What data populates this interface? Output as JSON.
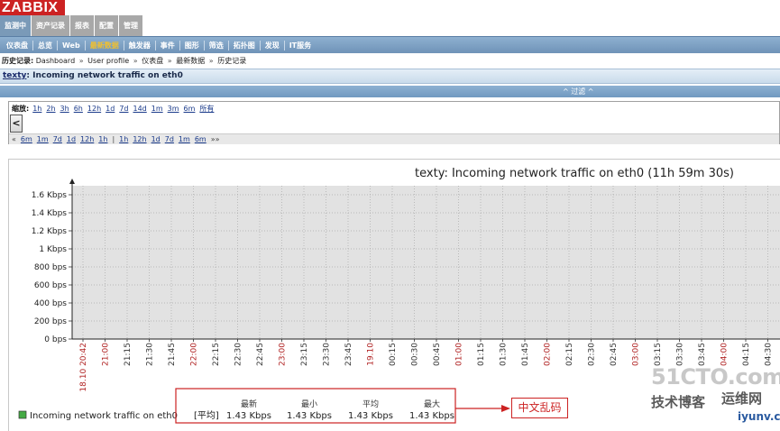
{
  "app": {
    "logo": "ZABBIX",
    "main_tabs": [
      "监测中",
      "资产记录",
      "报表",
      "配置",
      "管理"
    ],
    "submenu": [
      "仪表盘",
      "总览",
      "Web",
      "最新数据",
      "触发器",
      "事件",
      "图形",
      "筛选",
      "拓扑图",
      "发现",
      "IT服务"
    ],
    "submenu_active": "最新数据",
    "history": {
      "label": "历史记录:",
      "items": [
        "Dashboard",
        "User profile",
        "仪表盘",
        "最新数据",
        "历史记录"
      ],
      "separator": "»"
    },
    "page_title_host": "texty",
    "page_title_rest": ": Incoming network traffic on eth0",
    "filter_toggle": "^ 过滤 ^",
    "zoom": {
      "label": "缩放:",
      "options": [
        "1h",
        "2h",
        "3h",
        "6h",
        "12h",
        "1d",
        "7d",
        "14d",
        "1m",
        "3m",
        "6m",
        "所有"
      ],
      "nav_left": [
        "«",
        "6m",
        "1m",
        "7d",
        "1d",
        "12h",
        "1h"
      ],
      "nav_right": [
        "1h",
        "12h",
        "1d",
        "7d",
        "1m",
        "6m",
        "»»"
      ],
      "scroll_left": "<"
    },
    "annotation_label": "中文乱码",
    "watermark": {
      "site": "51CTO.com",
      "blog": "技术博客",
      "brand": "运维网",
      "url": "iyunv.com"
    }
  },
  "chart_data": {
    "type": "line",
    "title": "texty: Incoming network traffic on eth0 (11h 59m 30s)",
    "y_ticks": [
      "0 bps",
      "200 bps",
      "400 bps",
      "600 bps",
      "800 bps",
      "1 Kbps",
      "1.2 Kbps",
      "1.4 Kbps",
      "1.6 Kbps"
    ],
    "ylim": [
      0,
      1.6
    ],
    "grid": true,
    "x_ticks": [
      "18.10 20:42",
      "21:00",
      "21:15",
      "21:30",
      "21:45",
      "22:00",
      "22:15",
      "22:30",
      "22:45",
      "23:00",
      "23:15",
      "23:30",
      "23:45",
      "19.10",
      "00:15",
      "00:30",
      "00:45",
      "01:00",
      "01:15",
      "01:30",
      "01:45",
      "02:00",
      "02:15",
      "02:30",
      "02:45",
      "03:00",
      "03:15",
      "03:30",
      "03:45",
      "04:00",
      "04:15",
      "04:30"
    ],
    "x_tick_red": [
      "18.10 20:42",
      "21:00",
      "22:00",
      "23:00",
      "19.10",
      "01:00",
      "02:00",
      "03:00",
      "04:00"
    ],
    "series": [
      {
        "name": "Incoming network traffic on eth0",
        "color": "#44aa44",
        "func": "[平均]",
        "stats_headers": [
          "最新",
          "最小",
          "平均",
          "最大"
        ],
        "stats": [
          "1.43 Kbps",
          "1.43 Kbps",
          "1.43 Kbps",
          "1.43 Kbps"
        ]
      }
    ],
    "colors": {
      "plot_bg": "#e2e2e2",
      "grid": "#aaaaaa",
      "tick_red": "#b02222",
      "annot": "#cc2222"
    }
  }
}
